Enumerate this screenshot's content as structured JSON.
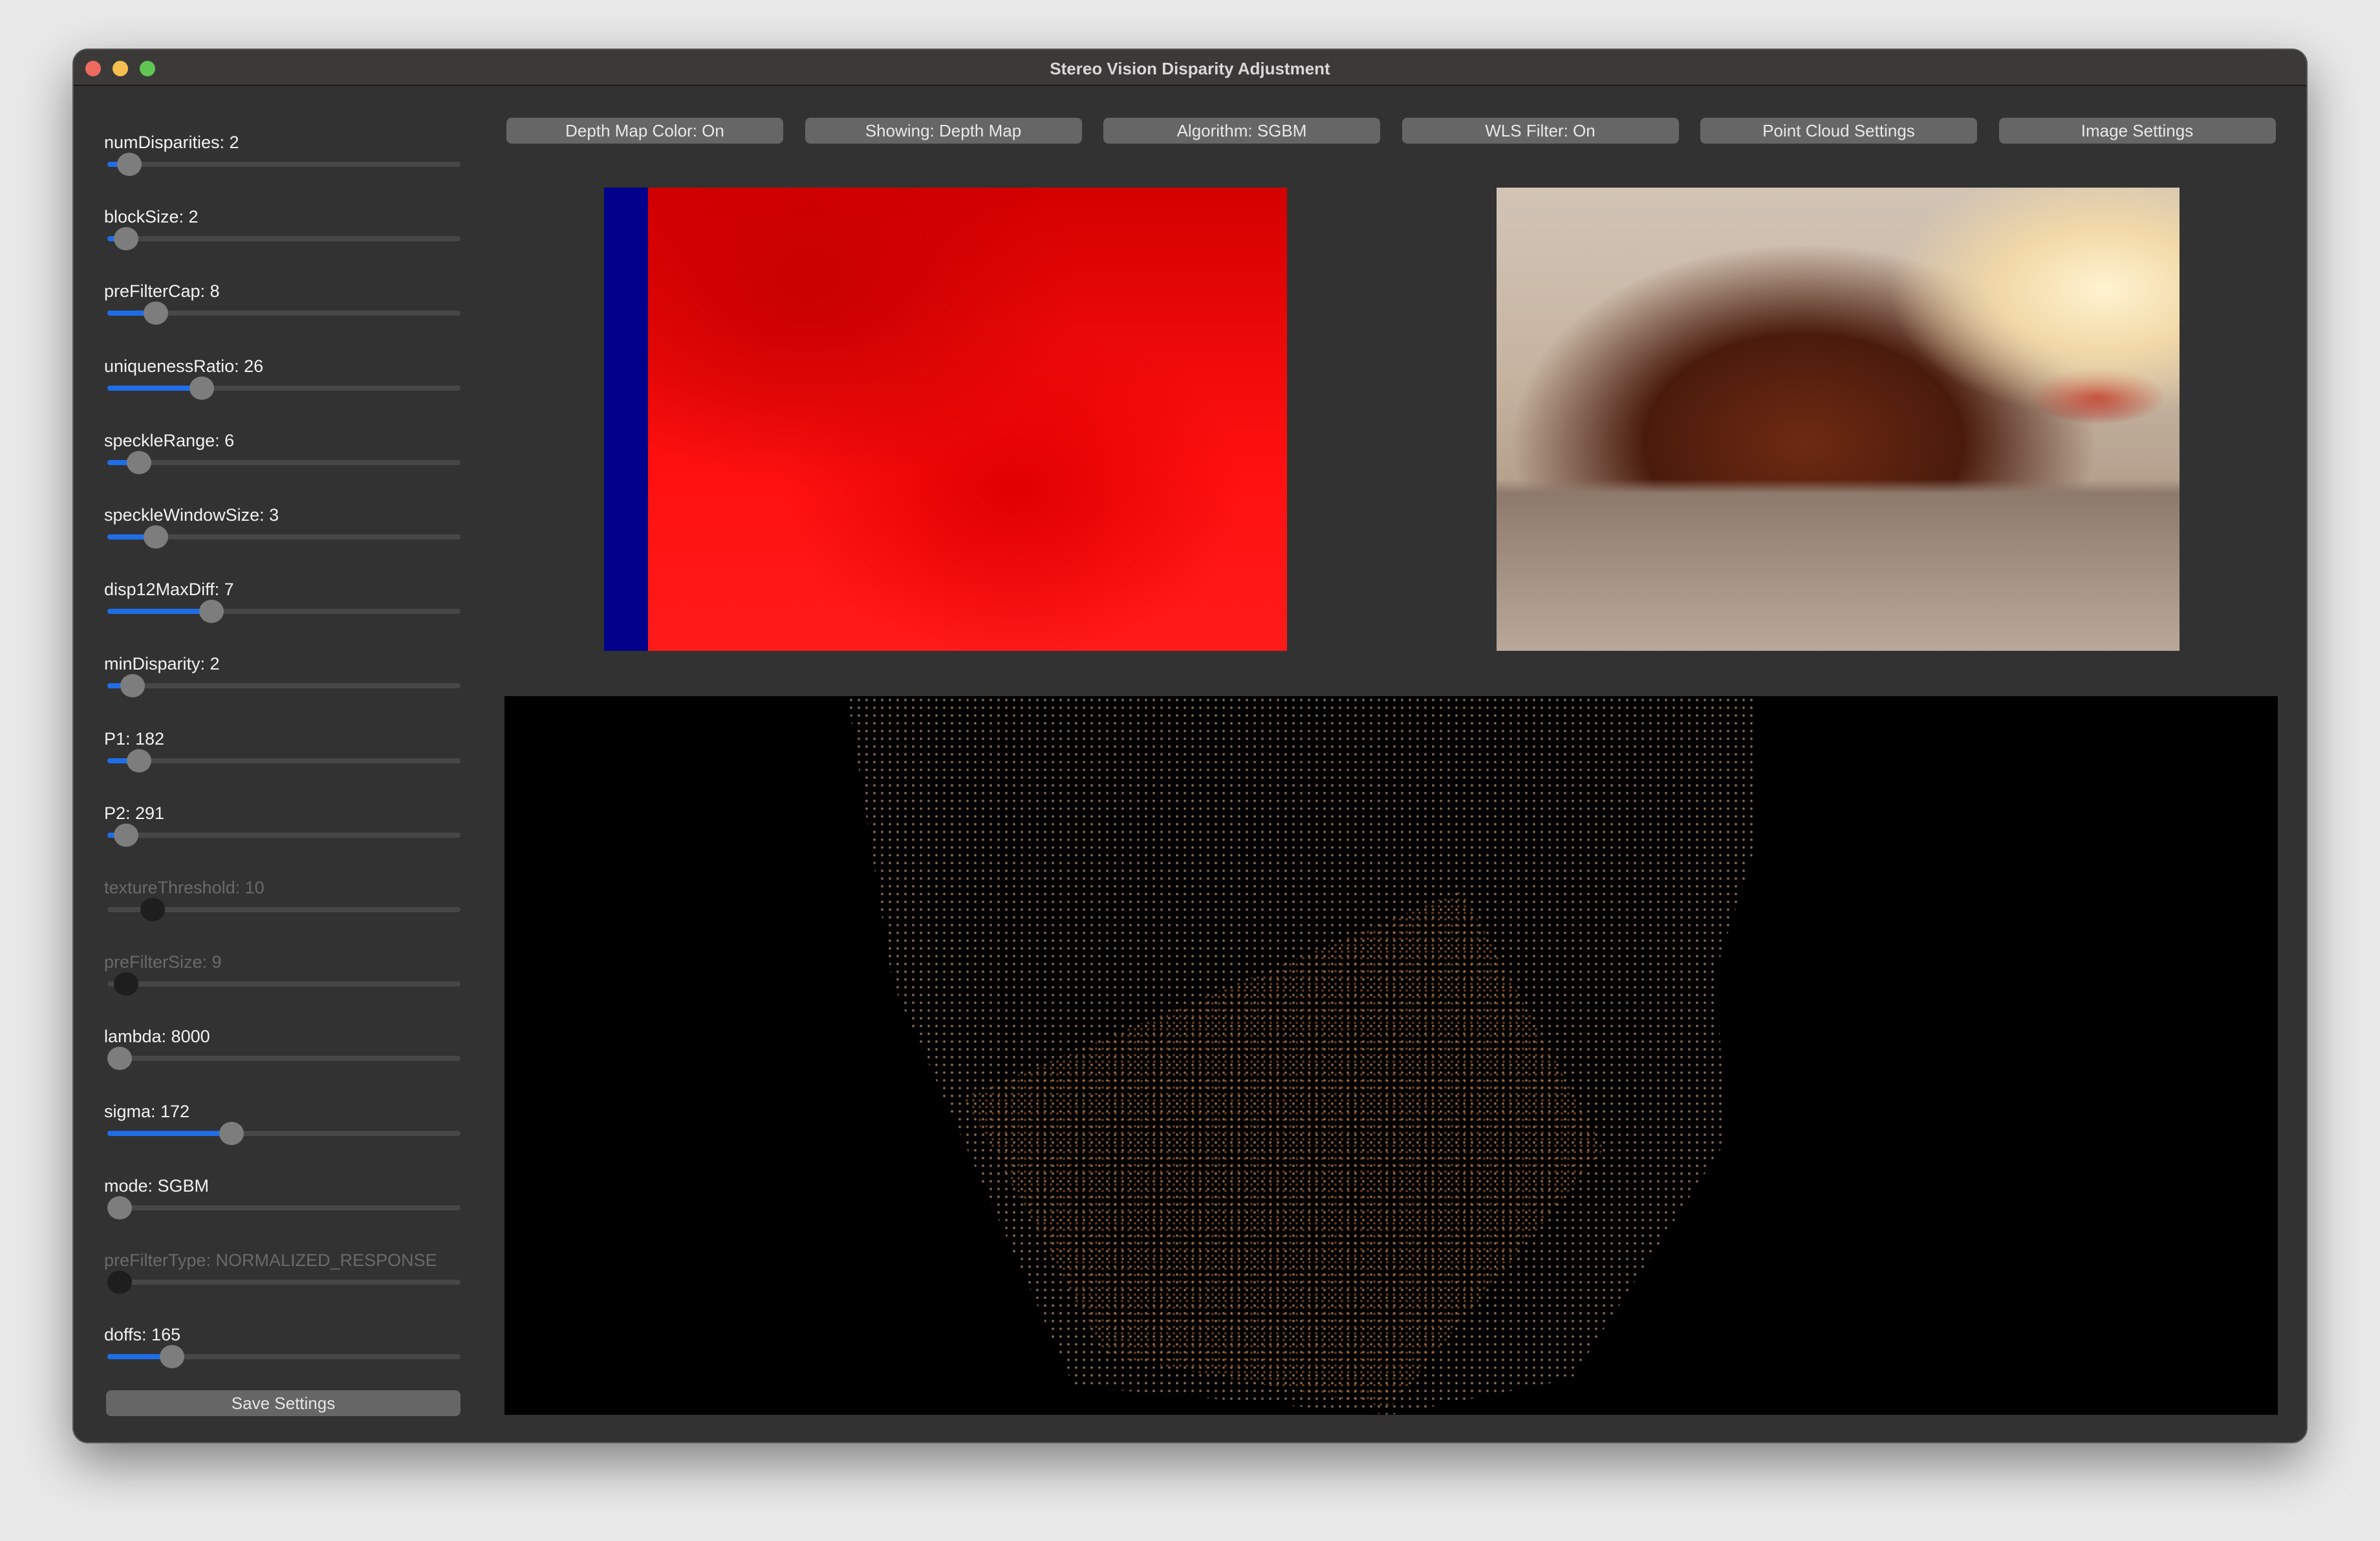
{
  "window": {
    "title": "Stereo Vision Disparity Adjustment",
    "traffic_lights": {
      "close": "#ee6a5f",
      "minimize": "#f5bf4f",
      "zoom": "#61c554"
    }
  },
  "accent_color": "#1f6ee8",
  "sidebar": {
    "sliders": [
      {
        "label": "numDisparities: 2",
        "value_fraction": 0.03,
        "enabled": true
      },
      {
        "label": "blockSize: 2",
        "value_fraction": 0.02,
        "enabled": true
      },
      {
        "label": "preFilterCap: 8",
        "value_fraction": 0.11,
        "enabled": true
      },
      {
        "label": "uniquenessRatio: 26",
        "value_fraction": 0.25,
        "enabled": true
      },
      {
        "label": "speckleRange: 6",
        "value_fraction": 0.06,
        "enabled": true
      },
      {
        "label": "speckleWindowSize: 3",
        "value_fraction": 0.11,
        "enabled": true
      },
      {
        "label": "disp12MaxDiff: 7",
        "value_fraction": 0.28,
        "enabled": true
      },
      {
        "label": "minDisparity: 2",
        "value_fraction": 0.04,
        "enabled": true
      },
      {
        "label": "P1: 182",
        "value_fraction": 0.06,
        "enabled": true
      },
      {
        "label": "P2: 291",
        "value_fraction": 0.02,
        "enabled": true
      },
      {
        "label": "textureThreshold: 10",
        "value_fraction": 0.1,
        "enabled": false
      },
      {
        "label": "preFilterSize: 9",
        "value_fraction": 0.02,
        "enabled": false
      },
      {
        "label": "lambda: 8000",
        "value_fraction": 0.0,
        "enabled": true
      },
      {
        "label": "sigma: 172",
        "value_fraction": 0.34,
        "enabled": true
      },
      {
        "label": "mode: SGBM",
        "value_fraction": 0.0,
        "enabled": true
      },
      {
        "label": "preFilterType: NORMALIZED_RESPONSE",
        "value_fraction": 0.0,
        "enabled": false
      },
      {
        "label": "doffs: 165",
        "value_fraction": 0.16,
        "enabled": true
      }
    ],
    "save_label": "Save Settings"
  },
  "toolbar": {
    "buttons": [
      {
        "label": "Depth Map Color: On"
      },
      {
        "label": "Showing: Depth Map"
      },
      {
        "label": "Algorithm: SGBM"
      },
      {
        "label": "WLS Filter: On"
      },
      {
        "label": "Point Cloud Settings"
      },
      {
        "label": "Image Settings"
      }
    ]
  }
}
